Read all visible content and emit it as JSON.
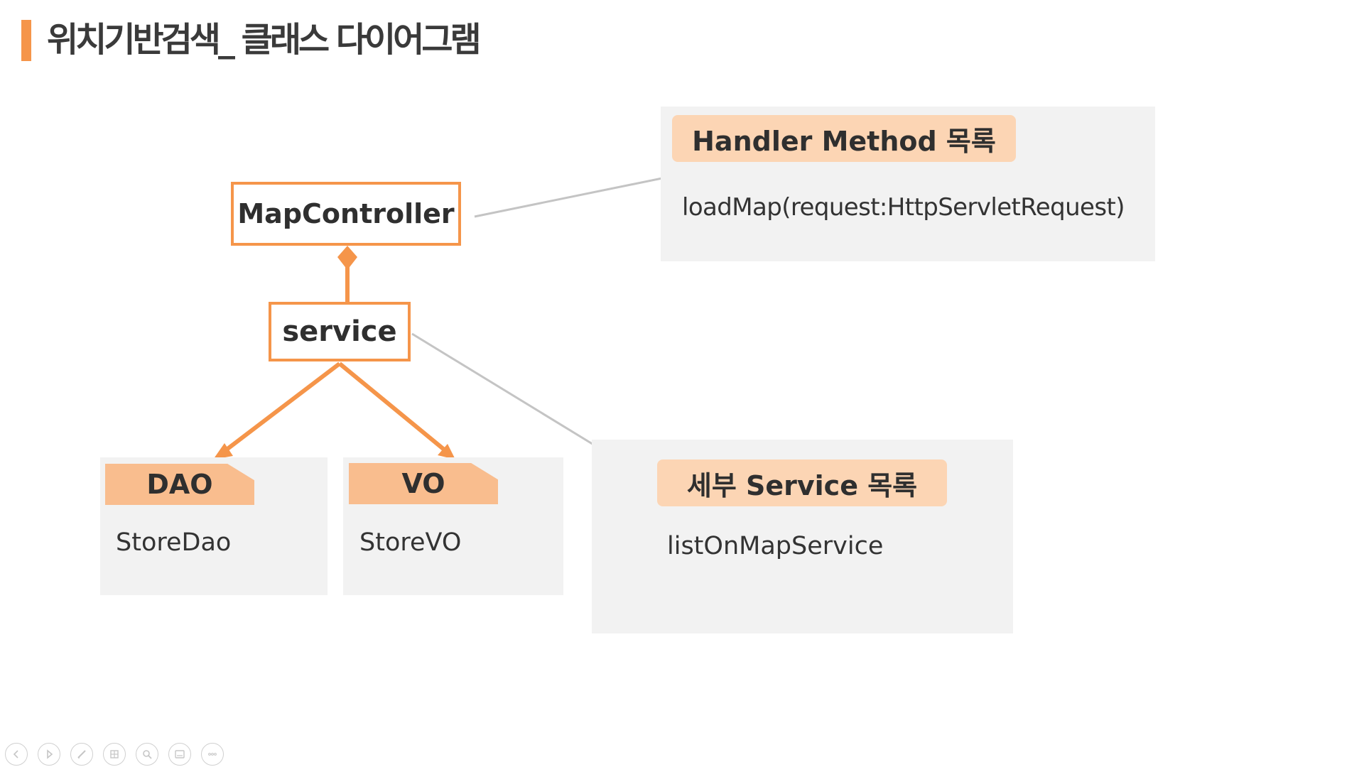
{
  "page": {
    "title": "위치기반검색_ 클래스 다이어그램"
  },
  "colors": {
    "accent": "#f5954a",
    "pill": "#fcd5b4",
    "tab": "#f9bd8e",
    "panel": "#f2f2f2",
    "connector_gray": "#c4c4c4"
  },
  "classes": {
    "map_controller": "MapController",
    "service": "service"
  },
  "handler_panel": {
    "heading": "Handler Method 목록",
    "method": "loadMap(request:HttpServletRequest)"
  },
  "service_panel": {
    "heading": "세부 Service 목록",
    "method": "listOnMapService"
  },
  "dao_panel": {
    "label": "DAO",
    "item": "StoreDao"
  },
  "vo_panel": {
    "label": "VO",
    "item": "StoreVO"
  },
  "toolbar": {
    "icons": [
      "prev-icon",
      "next-icon",
      "pen-icon",
      "slides-icon",
      "zoom-icon",
      "subtitle-icon",
      "more-icon"
    ]
  }
}
